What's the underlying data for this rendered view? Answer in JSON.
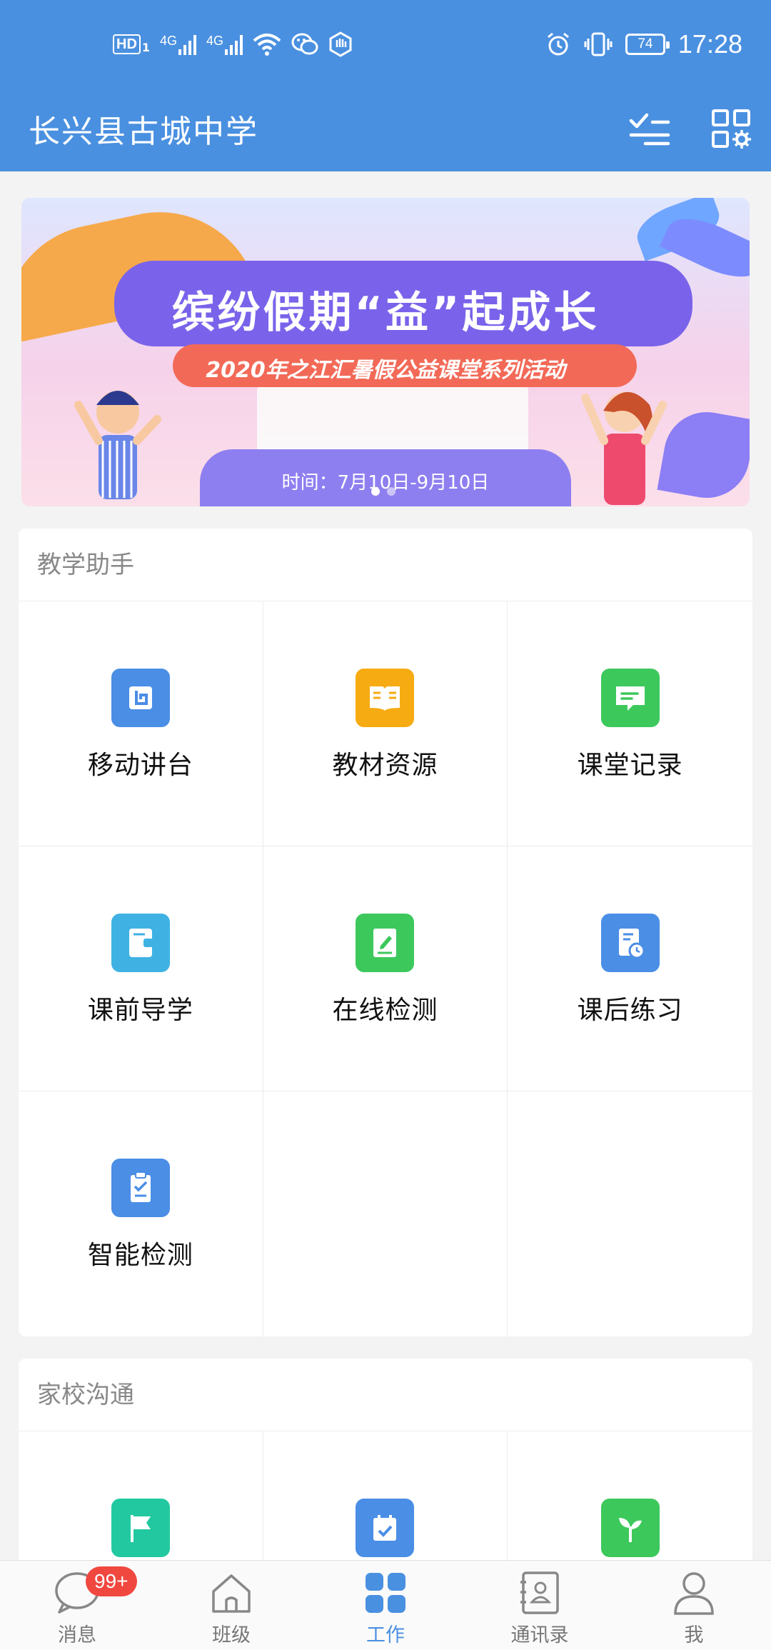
{
  "status_bar": {
    "hd_label": "HD",
    "sim_index": "1",
    "network_1": "4G",
    "network_2": "4G",
    "battery_level": "74",
    "time": "17:28"
  },
  "header": {
    "title": "长兴县古城中学",
    "bg_color": "#4a90e0"
  },
  "banner": {
    "headline": "缤纷假期“益”起成长",
    "subline": "2020年之江汇暑假公益课堂系列活动",
    "date_text": "时间：7月10日-9月10日",
    "slide_count": 2,
    "active_slide": 1
  },
  "sections": [
    {
      "title": "教学助手",
      "items": [
        {
          "label": "移动讲台",
          "icon": "podium-icon",
          "color": "#4a8ee6"
        },
        {
          "label": "教材资源",
          "icon": "textbook-icon",
          "color": "#f6ab12"
        },
        {
          "label": "课堂记录",
          "icon": "chat-record-icon",
          "color": "#3dc85c"
        },
        {
          "label": "课前导学",
          "icon": "wallet-guide-icon",
          "color": "#3fb2e3"
        },
        {
          "label": "在线检测",
          "icon": "edit-book-icon",
          "color": "#3dc85c"
        },
        {
          "label": "课后练习",
          "icon": "clock-doc-icon",
          "color": "#4a8ee6"
        },
        {
          "label": "智能检测",
          "icon": "clipboard-check-icon",
          "color": "#4a8ee6"
        }
      ]
    },
    {
      "title": "家校沟通",
      "items": [
        {
          "label": "",
          "icon": "flag-icon",
          "color": "#22c9a0"
        },
        {
          "label": "",
          "icon": "calendar-check-icon",
          "color": "#4a8ee6"
        },
        {
          "label": "",
          "icon": "sprout-icon",
          "color": "#3dc85c"
        }
      ]
    }
  ],
  "tabs": [
    {
      "label": "消息",
      "icon": "message-bubble-icon",
      "badge": "99+",
      "active": false
    },
    {
      "label": "班级",
      "icon": "home-icon",
      "active": false
    },
    {
      "label": "工作",
      "icon": "grid-work-icon",
      "active": true
    },
    {
      "label": "通讯录",
      "icon": "contacts-book-icon",
      "active": false
    },
    {
      "label": "我",
      "icon": "person-icon",
      "active": false
    }
  ],
  "colors": {
    "accent": "#4a90e0",
    "badge": "#f0473f",
    "inactive_tab": "#777777"
  }
}
